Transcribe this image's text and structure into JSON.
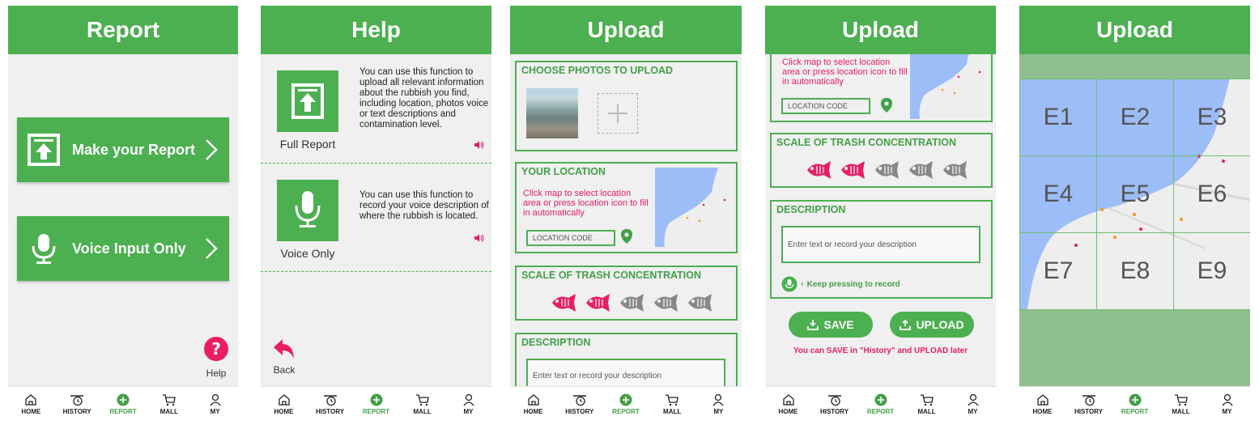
{
  "screens": {
    "report": {
      "title": "Report",
      "make_report_label": "Make your Report",
      "voice_input_label": "Voice Input Only",
      "help_label": "Help"
    },
    "help": {
      "title": "Help",
      "full_report_label": "Full Report",
      "full_report_text": "You can use this function to upload all relevant information about the rubbish you find, including location, photos voice or text descriptions and contamination level.",
      "voice_only_label": "Voice Only",
      "voice_only_text": "You can use this function to record your voice description of where the rubbish is located.",
      "back_label": "Back"
    },
    "upload1": {
      "title": "Upload",
      "photos_title": "CHOOSE PHOTOS TO UPLOAD",
      "location_title": "YOUR LOCATION",
      "location_hint": "Click map to select location area or press location icon to fill in automatically",
      "location_code_placeholder": "LOCATION CODE",
      "scale_title": "SCALE OF TRASH CONCENTRATION",
      "description_title": "DESCRIPTION",
      "description_placeholder": "Enter text or record your description"
    },
    "upload2": {
      "title": "Upload",
      "location_hint": "Click map to select location area or press location icon to fill in automatically",
      "location_code_placeholder": "LOCATION CODE",
      "scale_title": "SCALE OF TRASH CONCENTRATION",
      "description_title": "DESCRIPTION",
      "description_placeholder": "Enter text or record your description",
      "record_hint": "Keep pressing to record",
      "save_label": "SAVE",
      "upload_label": "UPLOAD",
      "footer_note": "You can SAVE in \"History\" and UPLOAD later"
    },
    "upload3": {
      "title": "Upload",
      "grid_cells": [
        "E1",
        "E2",
        "E3",
        "E4",
        "E5",
        "E6",
        "E7",
        "E8",
        "E9"
      ]
    }
  },
  "nav": {
    "home": "HOME",
    "history": "HISTORY",
    "report": "REPORT",
    "mall": "MALL",
    "my": "MY"
  },
  "scale": {
    "selected": 2,
    "total": 5
  },
  "colors": {
    "brand_green": "#4caf50",
    "accent_pink": "#e91e63",
    "water_blue": "#9dbdf8"
  }
}
